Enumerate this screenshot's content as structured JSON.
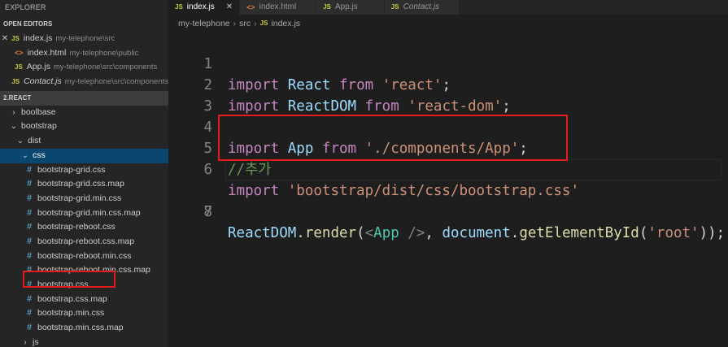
{
  "sidebar": {
    "header": "EXPLORER",
    "open_editors_title": "OPEN EDITORS",
    "open_editors": [
      {
        "name": "index.js",
        "path": "my-telephone\\src",
        "icon": "js-file-icon",
        "closable": true
      },
      {
        "name": "index.html",
        "path": "my-telephone\\public",
        "icon": "html-file-icon",
        "closable": false
      },
      {
        "name": "App.js",
        "path": "my-telephone\\src\\components",
        "icon": "js-file-icon",
        "closable": false
      },
      {
        "name": "Contact.js",
        "path": "my-telephone\\src\\components",
        "icon": "js-file-icon",
        "closable": false
      }
    ],
    "root_title": "2.REACT",
    "tree": [
      {
        "label": "boolbase",
        "type": "folder",
        "expanded": false
      },
      {
        "label": "bootstrap",
        "type": "folder",
        "expanded": true
      },
      {
        "label": "dist",
        "type": "folder",
        "expanded": true
      },
      {
        "label": "css",
        "type": "folder",
        "expanded": true
      },
      {
        "label": "bootstrap-grid.css",
        "type": "file"
      },
      {
        "label": "bootstrap-grid.css.map",
        "type": "file"
      },
      {
        "label": "bootstrap-grid.min.css",
        "type": "file"
      },
      {
        "label": "bootstrap-grid.min.css.map",
        "type": "file"
      },
      {
        "label": "bootstrap-reboot.css",
        "type": "file"
      },
      {
        "label": "bootstrap-reboot.css.map",
        "type": "file"
      },
      {
        "label": "bootstrap-reboot.min.css",
        "type": "file"
      },
      {
        "label": "bootstrap-reboot.min.css.map",
        "type": "file"
      },
      {
        "label": "bootstrap.css",
        "type": "file"
      },
      {
        "label": "bootstrap.css.map",
        "type": "file"
      },
      {
        "label": "bootstrap.min.css",
        "type": "file"
      },
      {
        "label": "bootstrap.min.css.map",
        "type": "file"
      },
      {
        "label": "js",
        "type": "folder",
        "expanded": false
      }
    ],
    "js_icon_glyph": "JS",
    "html_icon_glyph": "<>",
    "css_icon_glyph": "#",
    "close_glyph": "✕",
    "chevron_right": "›",
    "chevron_down": "⌄"
  },
  "tabs": [
    {
      "label": "index.js",
      "icon": "js-file-icon",
      "active": true,
      "close": "✕"
    },
    {
      "label": "index.html",
      "icon": "html-file-icon",
      "active": false
    },
    {
      "label": "App.js",
      "icon": "js-file-icon",
      "active": false
    },
    {
      "label": "Contact.js",
      "icon": "js-file-icon",
      "active": false,
      "italic": true
    }
  ],
  "breadcrumb": [
    "my-telephone",
    "src",
    "index.js"
  ],
  "breadcrumb_sep": "›",
  "editor": {
    "lines": [
      {
        "n": "1",
        "code": "import React from 'react';"
      },
      {
        "n": "2",
        "code": "import ReactDOM from 'react-dom';"
      },
      {
        "n": "3",
        "code": ""
      },
      {
        "n": "4",
        "code": "import App from './components/App';"
      },
      {
        "n": "5",
        "code": "//추가"
      },
      {
        "n": "6",
        "code": "import 'bootstrap/dist/css/bootstrap.css'"
      },
      {
        "n": "7",
        "code": ""
      },
      {
        "n": "8",
        "code": "ReactDOM.render(<App />, document.getElementById('root'));"
      }
    ]
  },
  "colors": {
    "keyword": "#c586c0",
    "variable": "#9cdcfe",
    "string": "#ce9178",
    "function": "#dcdcaa",
    "tag": "#4ec9b0",
    "comment": "#6a9955",
    "annotation_box": "#e31b1b",
    "selection": "#094771"
  }
}
